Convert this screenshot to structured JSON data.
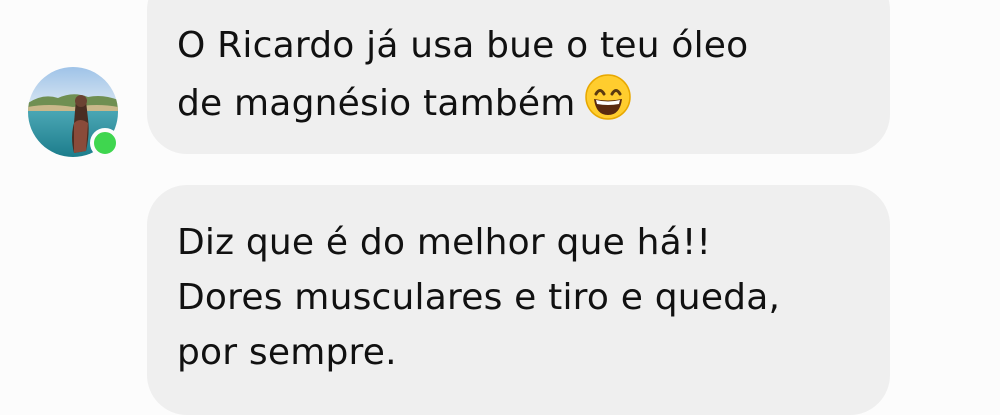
{
  "messages": [
    {
      "lines": [
        "O Ricardo já usa bue o teu óleo",
        "de magnésio também"
      ],
      "emoji": "grinning-face-with-smiling-eyes"
    },
    {
      "lines": [
        "Diz que é do melhor que há!!",
        "Dores musculares e tiro e queda,",
        "por sempre."
      ]
    }
  ],
  "sender": {
    "online": true,
    "avatar_icon": "profile-photo-beach"
  },
  "colors": {
    "bubble": "#efefef",
    "background": "#fcfcfc",
    "online": "#3fd64f",
    "text": "#111111"
  }
}
